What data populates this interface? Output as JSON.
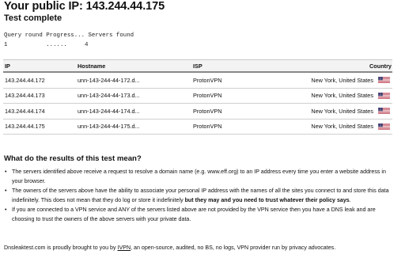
{
  "header": {
    "public_ip_title": "Your public IP: 143.244.44.175",
    "status": "Test complete"
  },
  "progress": {
    "head": "Query round Progress... Servers found",
    "values": "1           ......     4"
  },
  "table": {
    "columns": [
      "IP",
      "Hostname",
      "ISP",
      "Country"
    ],
    "rows": [
      {
        "ip": "143.244.44.172",
        "hostname": "unn-143-244-44-172.d...",
        "isp": "ProtonVPN",
        "country": "New York, United States",
        "flag": "us-flag-icon"
      },
      {
        "ip": "143.244.44.173",
        "hostname": "unn-143-244-44-173.d...",
        "isp": "ProtonVPN",
        "country": "New York, United States",
        "flag": "us-flag-icon"
      },
      {
        "ip": "143.244.44.174",
        "hostname": "unn-143-244-44-174.d...",
        "isp": "ProtonVPN",
        "country": "New York, United States",
        "flag": "us-flag-icon"
      },
      {
        "ip": "143.244.44.175",
        "hostname": "unn-143-244-44-175.d...",
        "isp": "ProtonVPN",
        "country": "New York, United States",
        "flag": "us-flag-icon"
      }
    ]
  },
  "explanation": {
    "title": "What do the results of this test mean?",
    "bullet1": "The servers identified above receive a request to resolve a domain name (e.g. www.eff.org) to an IP address every time you enter a website address in your browser.",
    "bullet2_text": "The owners of the servers above have the ability to associate your personal IP address with the names of all the sites you connect to and store this data indefinitely. This does not mean that they do log or store it indefinitely ",
    "bullet2_bold": "but they may and you need to trust whatever their policy says",
    "bullet2_end": ".",
    "bullet3": "If you are connected to a VPN service and ANY of the servers listed above are not provided by the VPN service then you have a DNS leak and are choosing to trust the owners of the above servers with your private data."
  },
  "footer": {
    "prefix": "Dnsleaktest.com is proudly brought to you by ",
    "link": "IVPN",
    "suffix": ", an open-source, audited, no BS, no logs, VPN provider run by privacy advocates."
  },
  "colors": {
    "flag_red": "#b22234",
    "flag_blue": "#3c3b6e",
    "header_border": "#888888"
  }
}
